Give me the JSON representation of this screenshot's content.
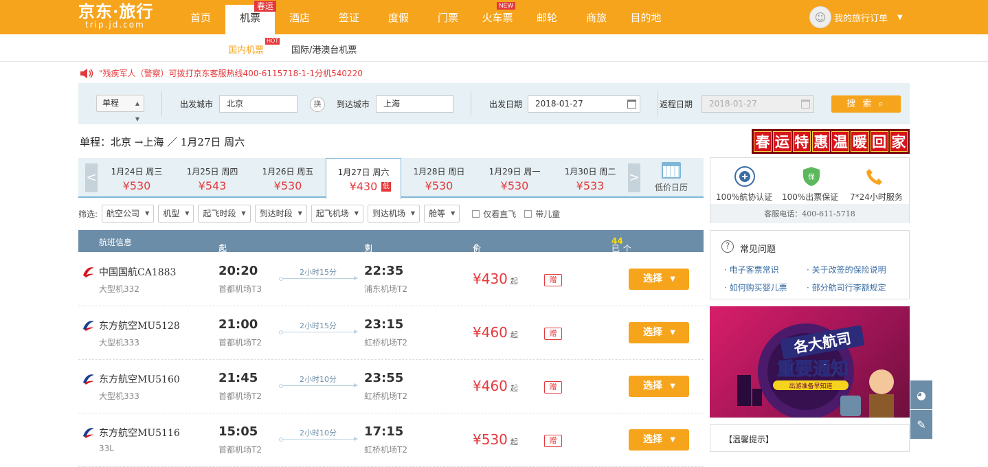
{
  "header": {
    "logo_cn": "京东·旅行",
    "logo_en": "trip.jd.com",
    "nav": [
      {
        "label": "首页"
      },
      {
        "label": "机票",
        "badge": "春运",
        "active": true
      },
      {
        "label": "酒店"
      },
      {
        "label": "签证"
      },
      {
        "label": "度假"
      },
      {
        "label": "门票"
      },
      {
        "label": "火车票",
        "badge": "NEW"
      },
      {
        "label": "邮轮"
      },
      {
        "label": "商旅"
      },
      {
        "label": "目的地"
      }
    ],
    "user_orders": "我的旅行订单"
  },
  "subnav": {
    "domestic": "国内机票",
    "hot": "HOT",
    "intl": "国际/港澳台机票"
  },
  "notice": "\"残疾军人（警察）可拨打京东客服热线400-6115718-1-1分机540220",
  "search": {
    "trip_type": "单程",
    "from_label": "出发城市",
    "from_value": "北京",
    "swap": "换",
    "to_label": "到达城市",
    "to_value": "上海",
    "depart_label": "出发日期",
    "depart_value": "2018-01-27",
    "return_label": "返程日期",
    "return_value": "2018-01-27",
    "button": "搜 索"
  },
  "route_summary": "单程：北京 →上海 ／ 1月27日 周六",
  "promo": [
    "春",
    "运",
    "特",
    "惠",
    "温",
    "暖",
    "回",
    "家"
  ],
  "dates": [
    {
      "date": "1月24日 周三",
      "price": "¥530"
    },
    {
      "date": "1月25日 周四",
      "price": "¥543"
    },
    {
      "date": "1月26日 周五",
      "price": "¥530"
    },
    {
      "date": "1月27日 周六",
      "price": "¥430",
      "active": true,
      "tag": "低"
    },
    {
      "date": "1月28日 周日",
      "price": "¥530"
    },
    {
      "date": "1月29日 周一",
      "price": "¥530"
    },
    {
      "date": "1月30日 周二",
      "price": "¥533"
    }
  ],
  "low_price_calendar": "低价日历",
  "filters": {
    "label": "筛选:",
    "dropdowns": [
      "航空公司",
      "机型",
      "起飞时段",
      "到达时段",
      "起飞机场",
      "到达机场",
      "舱等"
    ],
    "checkboxes": [
      "仅看直飞",
      "带儿童"
    ]
  },
  "table_header": {
    "flight": "航班信息",
    "depart": "起飞时间",
    "arrive": "到达时间",
    "price": "价格",
    "found_prefix": "已为您找到",
    "found_count": "44",
    "found_suffix": "个航班"
  },
  "flights": [
    {
      "airline": "中国国航CA1883",
      "plane": "大型机332",
      "dep": "20:20",
      "dep_ap": "首都机场T3",
      "dur": "2小时15分",
      "arr": "22:35",
      "arr_ap": "浦东机场T2",
      "price": "¥430",
      "from": "起",
      "gift": "赠",
      "choose": "选择",
      "logo_color": "#d7151b"
    },
    {
      "airline": "东方航空MU5128",
      "plane": "大型机333",
      "dep": "21:00",
      "dep_ap": "首都机场T2",
      "dur": "2小时15分",
      "arr": "23:15",
      "arr_ap": "虹桥机场T2",
      "price": "¥460",
      "from": "起",
      "gift": "赠",
      "choose": "选择",
      "logo_color": "#1a3d8f"
    },
    {
      "airline": "东方航空MU5160",
      "plane": "大型机333",
      "dep": "21:45",
      "dep_ap": "首都机场T2",
      "dur": "2小时10分",
      "arr": "23:55",
      "arr_ap": "虹桥机场T2",
      "price": "¥460",
      "from": "起",
      "gift": "赠",
      "choose": "选择",
      "logo_color": "#1a3d8f"
    },
    {
      "airline": "东方航空MU5116",
      "plane": "33L",
      "dep": "15:05",
      "dep_ap": "首都机场T2",
      "dur": "2小时10分",
      "arr": "17:15",
      "arr_ap": "虹桥机场T2",
      "price": "¥530",
      "from": "起",
      "gift": "赠",
      "choose": "选择",
      "logo_color": "#1a3d8f"
    }
  ],
  "guarantees": {
    "items": [
      "100%航协认证",
      "100%出票保证",
      "7*24小时服务"
    ],
    "phone_label": "客服电话：",
    "phone": "400-611-5718"
  },
  "faq": {
    "title": "常见问题",
    "links": [
      "电子客票常识",
      "关于改签的保险说明",
      "如何购买婴儿票",
      "部分航司行李额规定"
    ]
  },
  "banner": {
    "line1": "各大航司",
    "line2": "重要通知",
    "line3": "出游准备早知道"
  },
  "tip_title": "【温馨提示】",
  "colors": {
    "brand": "#f6a41c",
    "price": "#e4393c",
    "header_blue": "#6c8da7"
  }
}
